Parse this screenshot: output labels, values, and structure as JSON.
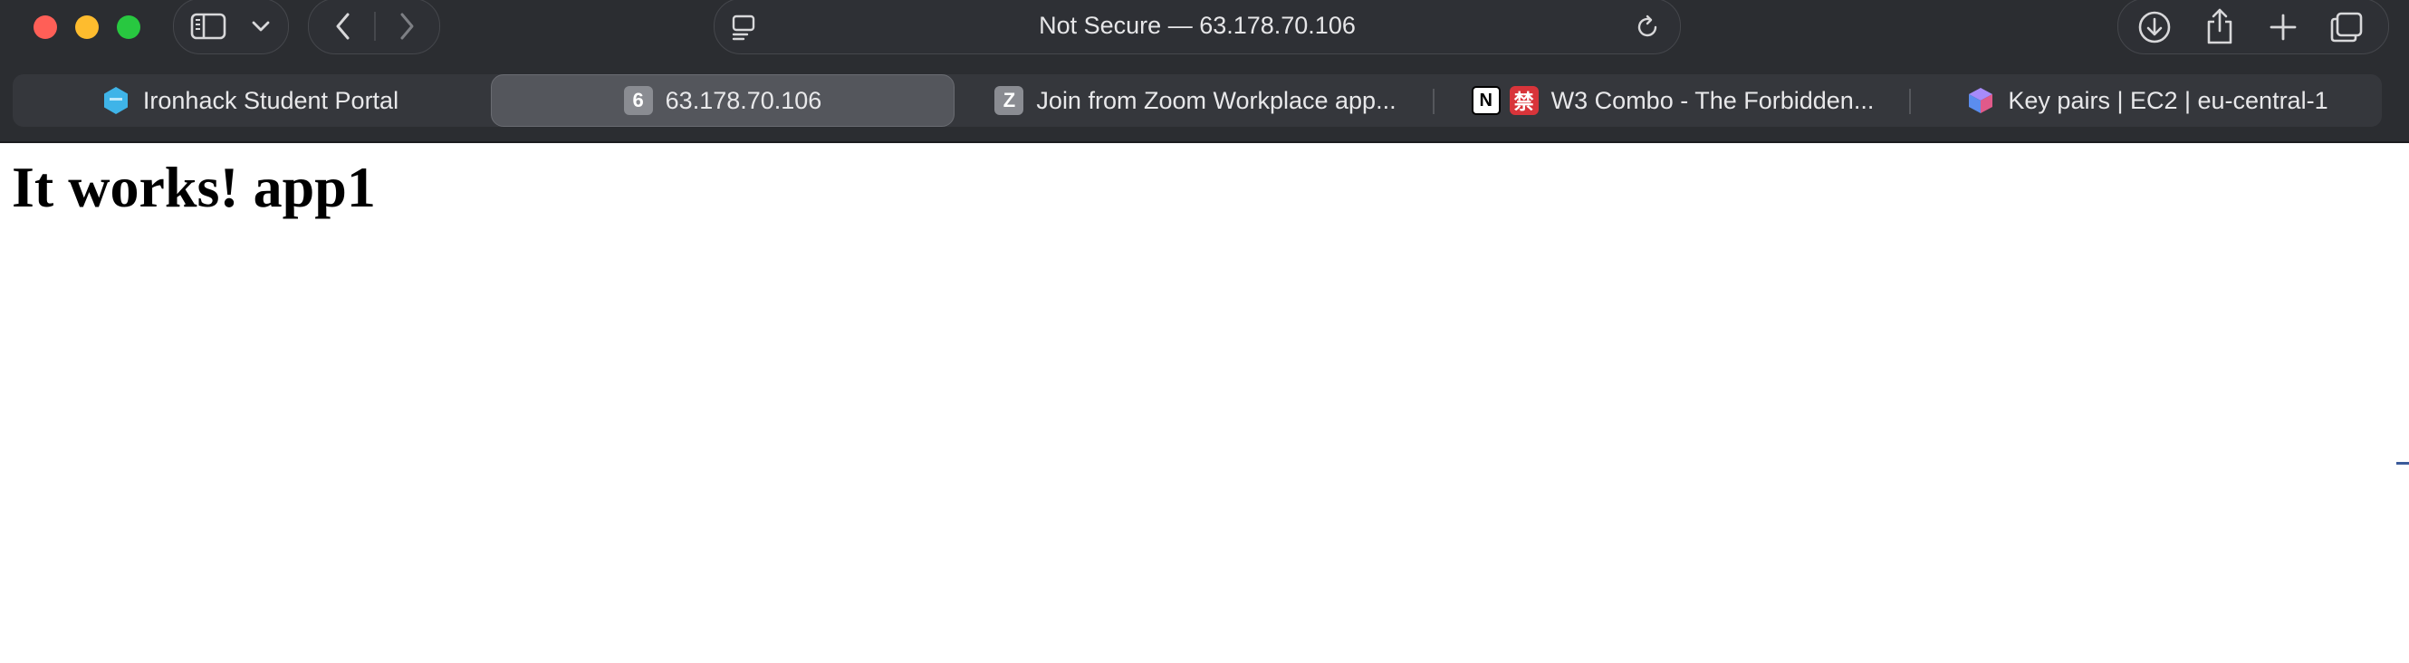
{
  "window": {
    "address_bar_text": "Not Secure — 63.178.70.106"
  },
  "toolbar": {
    "icons": {
      "sidebar": "sidebar-icon",
      "sidebar_menu": "chevron-down-icon",
      "back": "back-chevron-icon",
      "forward": "forward-chevron-icon",
      "page_menu": "page-menu-icon",
      "reload": "reload-icon",
      "downloads": "download-icon",
      "share": "share-icon",
      "new_tab": "plus-icon",
      "tab_overview": "tab-overview-icon"
    }
  },
  "tabs": [
    {
      "label": "Ironhack Student Portal",
      "favicon": "hexagon-logo-icon",
      "active": false
    },
    {
      "label": "63.178.70.106",
      "favicon_letter": "6",
      "active": true
    },
    {
      "label": "Join from Zoom Workplace app...",
      "favicon_letter": "Z",
      "active": false
    },
    {
      "label": "W3 Combo - The Forbidden...",
      "favicon": "notion-icon",
      "favicon_text": "N",
      "favicon2_text": "禁",
      "active": false
    },
    {
      "label": "Key pairs | EC2 | eu-central-1",
      "favicon": "cube-icon",
      "active": false
    }
  ],
  "page": {
    "heading": "It works! app1"
  },
  "colors": {
    "chrome_bg": "#2b2d31",
    "tab_active": "#54565c",
    "close": "#ff5f57",
    "minimize": "#febc2e",
    "maximize": "#28c840"
  }
}
